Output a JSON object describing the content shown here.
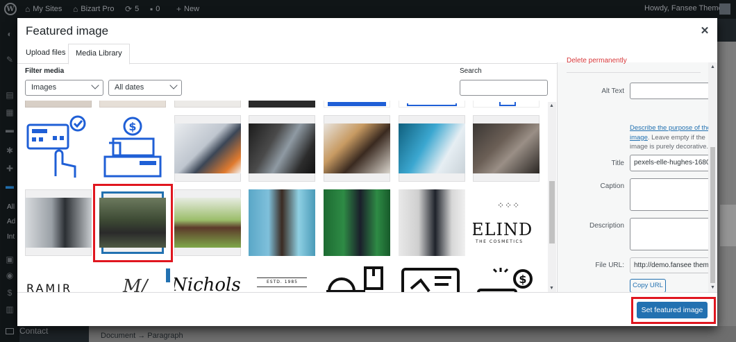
{
  "admin_bar": {
    "my_sites": "My Sites",
    "site_name": "Bizart Pro",
    "updates_count": "5",
    "comments_count": "0",
    "new_label": "New",
    "greeting": "Howdy, Fansee Themes"
  },
  "admin_menu": {
    "items": [
      "All",
      "Ad",
      "Int"
    ],
    "contact": "Contact"
  },
  "editor": {
    "breadcrumb": "Document → Paragraph"
  },
  "modal": {
    "title": "Featured image",
    "close_icon": "close-icon",
    "tabs": [
      {
        "label": "Upload files",
        "active": false
      },
      {
        "label": "Media Library",
        "active": true
      }
    ],
    "filter_label": "Filter media",
    "type_filter": "Images",
    "date_filter": "All dates",
    "search_label": "Search",
    "search_value": "",
    "selected_index": 8,
    "grid_logo_text": {
      "elind": "ELIND",
      "elind_sub": "THE COSMETICS",
      "ramir": "RAMIR",
      "script_a": "M/",
      "script_b": "Nichols",
      "estd": "ESTD. 1985"
    },
    "details": {
      "delete_link": "Delete permanently",
      "alt_text_label": "Alt Text",
      "alt_text_value": "",
      "alt_help_link": "Describe the purpose of the image",
      "alt_help_text": ". Leave empty if the image is purely decorative.",
      "title_label": "Title",
      "title_value": "pexels-elle-hughes-1680",
      "caption_label": "Caption",
      "caption_value": "",
      "description_label": "Description",
      "description_value": "",
      "file_url_label": "File URL:",
      "file_url_value": "http://demo.fansee themes",
      "copy_url_label": "Copy URL"
    },
    "footer": {
      "set_featured_label": "Set featured image"
    }
  },
  "colors": {
    "primary": "#2271b1",
    "highlight": "#e0161f",
    "danger": "#d63638"
  }
}
